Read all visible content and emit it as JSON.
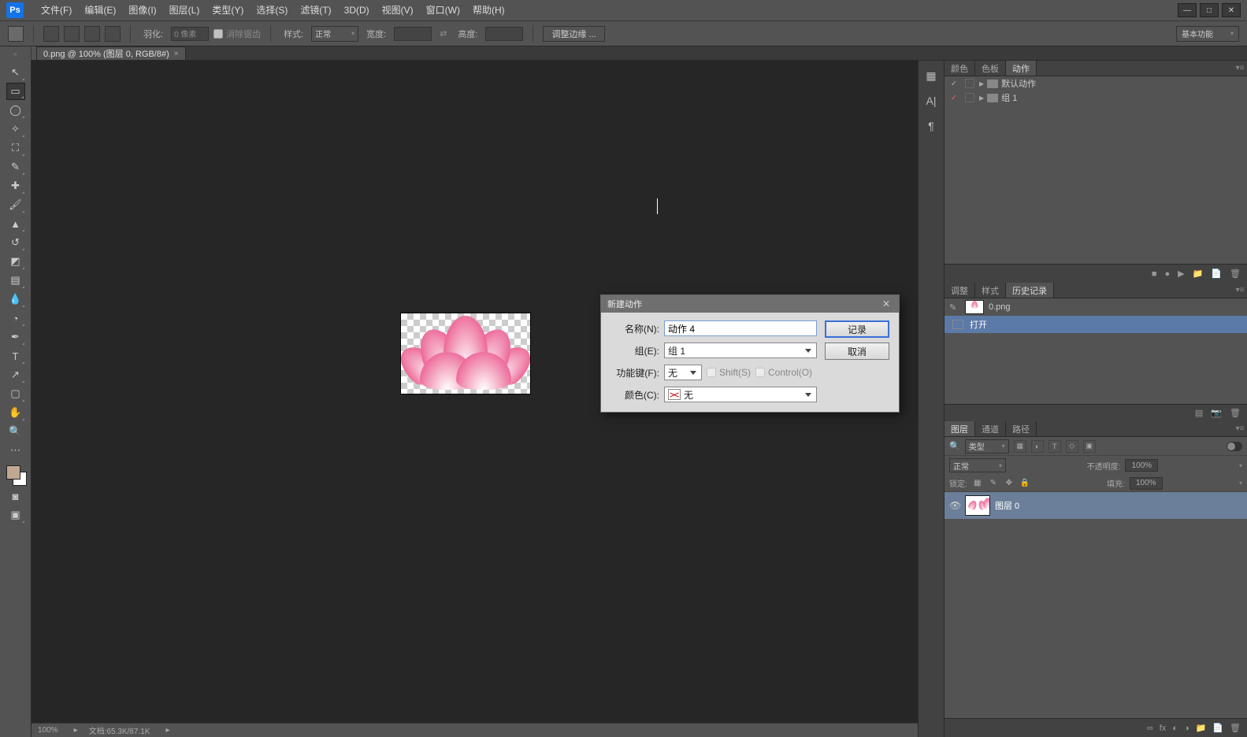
{
  "menu": {
    "items": [
      "文件(F)",
      "编辑(E)",
      "图像(I)",
      "图层(L)",
      "类型(Y)",
      "选择(S)",
      "滤镜(T)",
      "3D(D)",
      "视图(V)",
      "窗口(W)",
      "帮助(H)"
    ]
  },
  "options": {
    "feather_label": "羽化:",
    "feather_value": "0 像素",
    "antialias_label": "消除锯齿",
    "style_label": "样式:",
    "style_value": "正常",
    "width_label": "宽度:",
    "height_label": "高度:",
    "refine_edge": "调整边缘 ...",
    "workspace": "基本功能"
  },
  "document": {
    "tab": "0.png @ 100% (图层 0, RGB/8#)"
  },
  "dialog": {
    "title": "新建动作",
    "name_label": "名称(N):",
    "name_value": "动作 4",
    "set_label": "组(E):",
    "set_value": "组 1",
    "fkey_label": "功能键(F):",
    "fkey_value": "无",
    "shift_label": "Shift(S)",
    "ctrl_label": "Control(O)",
    "color_label": "颜色(C):",
    "color_value": "无",
    "record_btn": "记录",
    "cancel_btn": "取消"
  },
  "status": {
    "zoom": "100%",
    "doc": "文档:65.3K/87.1K"
  },
  "actions_panel": {
    "tabs": [
      "颜色",
      "色板",
      "动作"
    ],
    "rows": [
      {
        "label": "默认动作",
        "checked": true
      },
      {
        "label": "组 1",
        "checked": true
      }
    ]
  },
  "history_panel": {
    "tabs": [
      "调整",
      "样式",
      "历史记录"
    ],
    "doc_name": "0.png",
    "items": [
      {
        "label": "打开",
        "selected": true
      }
    ]
  },
  "layers_panel": {
    "tabs": [
      "图层",
      "通道",
      "路径"
    ],
    "filter_label": "类型",
    "blend_mode": "正常",
    "opacity_label": "不透明度:",
    "opacity_value": "100%",
    "lock_label": "锁定:",
    "fill_label": "填充:",
    "fill_value": "100%",
    "layers": [
      {
        "name": "图层 0"
      }
    ]
  }
}
